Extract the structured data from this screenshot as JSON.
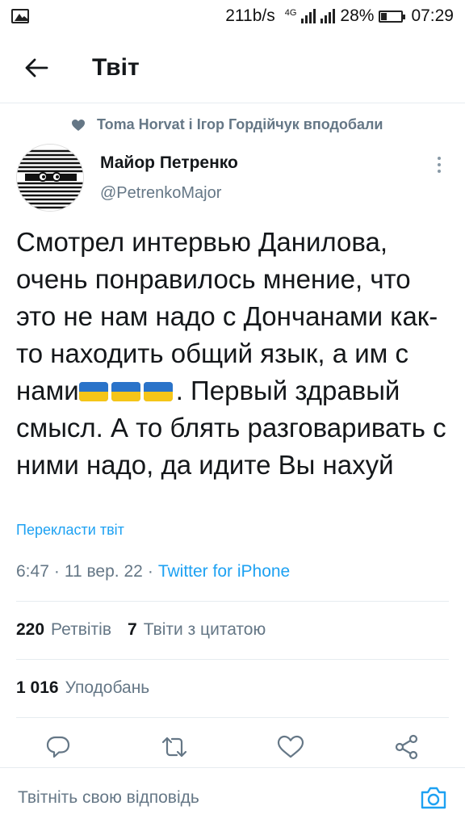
{
  "status_bar": {
    "net_speed": "211b/s",
    "network_tag": "4G",
    "battery_pct": "28%",
    "battery_level": 0.28,
    "time": "07:29"
  },
  "header": {
    "title": "Твіт"
  },
  "liked_by": {
    "text": "Toma Horvat і Ігор Гордійчук вподобали"
  },
  "author": {
    "name": "Майор Петренко",
    "handle": "@PetrenkoMajor"
  },
  "tweet": {
    "text_part1": "Смотрел интервью Данилова, очень понравилось мнение, что это не нам надо с Дончанами как-то находить общий язык, а им с нами",
    "flags": [
      "🇺🇦",
      "🇺🇦",
      "🇺🇦"
    ],
    "text_part2": ". Первый здравый смысл. А то блять разговаривать с ними надо, да идите Вы нахуй",
    "translate_label": "Перекласти твіт",
    "time": "6:47",
    "date": "11 вер. 22",
    "separator": "·",
    "source": "Twitter for iPhone"
  },
  "stats": {
    "retweets_count": "220",
    "retweets_label": "Ретвітів",
    "quotes_count": "7",
    "quotes_label": "Твіти з цитатою",
    "likes_count": "1 016",
    "likes_label": "Уподобань"
  },
  "actions": {
    "icons": [
      "reply-icon",
      "retweet-icon",
      "like-icon",
      "share-icon"
    ]
  },
  "reply_bar": {
    "placeholder": "Твітніть свою відповідь"
  },
  "colors": {
    "accent": "#1da1f2",
    "secondary_text": "#657786",
    "primary_text": "#14171a",
    "divider": "#e6ecf0"
  }
}
